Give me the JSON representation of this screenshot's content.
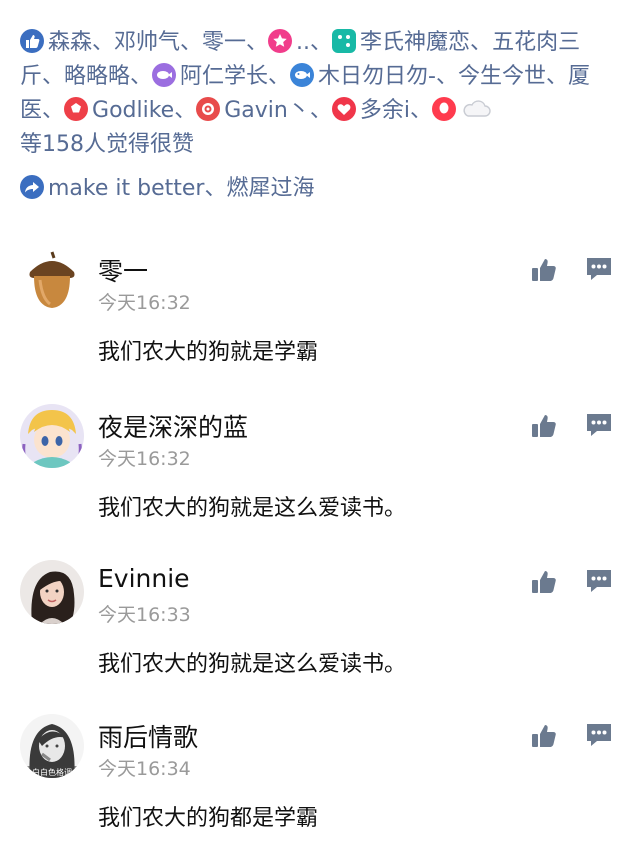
{
  "likes": {
    "n1": "森森、",
    "n2": "邓帅气、",
    "n3": "零一、",
    "n4": "..、",
    "n5": "李氏神魔恋、",
    "n6": "五花肉三斤、",
    "n7": "略略略、",
    "n8": "阿仁学长、",
    "n9": "木日勿日勿-、",
    "n10": "今生今世、",
    "n11": "厦医、",
    "n12": "Godlike、",
    "n13": "Gavin丶、",
    "n14": "多余i、",
    "summary": "等158人觉得很赞"
  },
  "shares": {
    "text": "make it better、燃犀过海"
  },
  "comments": [
    {
      "name": "零一",
      "time": "今天16:32",
      "text": "我们农大的狗就是学霸"
    },
    {
      "name": "夜是深深的蓝",
      "time": "今天16:32",
      "text": "我们农大的狗就是这么爱读书。"
    },
    {
      "name": "Evinnie",
      "time": "今天16:33",
      "text": "我们农大的狗就是这么爱读书。"
    },
    {
      "name": "雨后情歌",
      "time": "今天16:34",
      "text": "我们农大的狗都是学霸",
      "avatar_caption": "白白色格调"
    }
  ],
  "colors": {
    "link": "#566b94",
    "accent": "#3b6ec0",
    "icon_gray": "#6b7a8f"
  }
}
